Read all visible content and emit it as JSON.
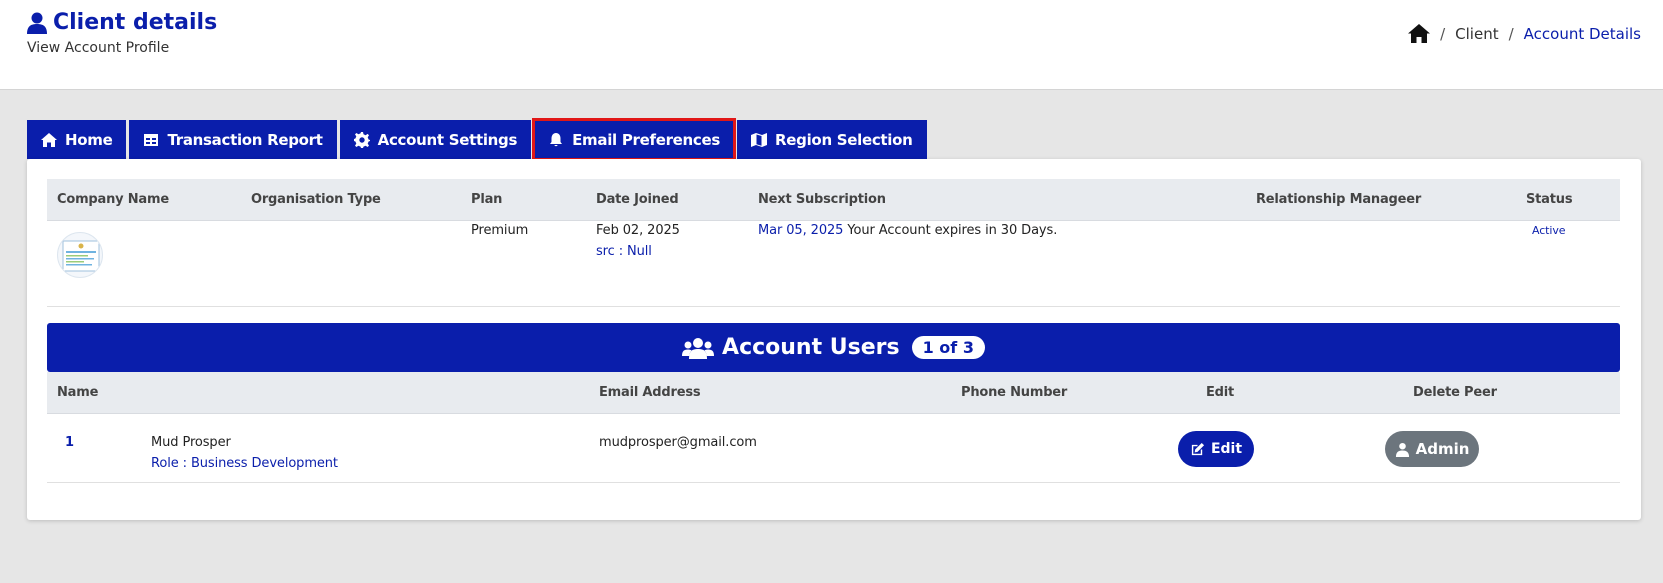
{
  "header": {
    "title": "Client details",
    "subtitle": "View Account Profile",
    "breadcrumb": {
      "level1": "Client",
      "separator": "/",
      "current": "Account Details"
    }
  },
  "tabs": [
    {
      "label": "Home",
      "icon": "home-icon"
    },
    {
      "label": "Transaction Report",
      "icon": "table-icon"
    },
    {
      "label": "Account Settings",
      "icon": "gear-icon"
    },
    {
      "label": "Email Preferences",
      "icon": "bell-icon"
    },
    {
      "label": "Region Selection",
      "icon": "map-icon"
    }
  ],
  "account": {
    "columns": {
      "company": "Company Name",
      "org_type": "Organisation Type",
      "plan": "Plan",
      "date_joined": "Date Joined",
      "next_sub": "Next Subscription",
      "manager": "Relationship Manageer",
      "status": "Status"
    },
    "row": {
      "plan": "Premium",
      "date_joined": "Feb 02, 2025",
      "src": "src : Null",
      "next_date": "Mar 05, 2025",
      "expiry_note": "Your Account expires in 30 Days.",
      "status": "Active"
    }
  },
  "users": {
    "title": "Account Users",
    "count_badge": "1 of 3",
    "columns": {
      "name": "Name",
      "email": "Email Address",
      "phone": "Phone Number",
      "edit": "Edit",
      "delete": "Delete Peer"
    },
    "rows": [
      {
        "index": "1",
        "name": "Mud Prosper",
        "role": "Role : Business Development",
        "email": "mudprosper@gmail.com",
        "phone": "",
        "edit_label": "Edit",
        "admin_label": "Admin"
      }
    ]
  },
  "colors": {
    "brand": "#0a1eab",
    "highlight": "#e11717",
    "muted_button": "#6c757d"
  }
}
